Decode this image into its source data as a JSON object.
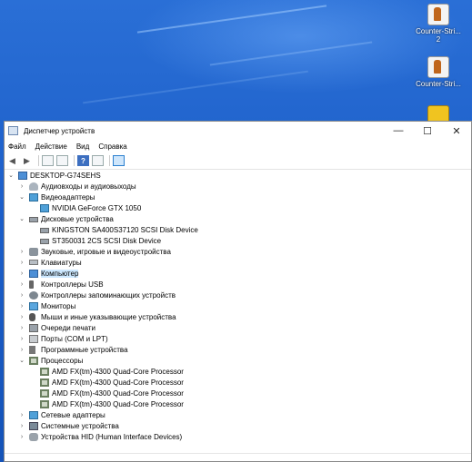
{
  "desktop": {
    "icons": [
      {
        "label": "Counter-Strike 2",
        "line1": "Counter-Stri...",
        "line2": "2"
      },
      {
        "label": "Counter-Strike",
        "line1": "Counter-Stri...",
        "line2": ""
      }
    ]
  },
  "window": {
    "title": "Диспетчер устройств",
    "controls": {
      "minimize": "—",
      "maximize": "☐",
      "close": "✕"
    }
  },
  "menu": [
    "Файл",
    "Действие",
    "Вид",
    "Справка"
  ],
  "toolbar": {
    "back": "◀",
    "forward": "▶",
    "help": "?"
  },
  "tree": {
    "root": "DESKTOP-G74SEHS",
    "expanded_arrow": "⌄",
    "collapsed_arrow": "›",
    "items": [
      {
        "label": "Аудиовходы и аудиовыходы",
        "icon": "audio-icon",
        "expanded": false,
        "children": []
      },
      {
        "label": "Видеоадаптеры",
        "icon": "display-adapter-icon",
        "expanded": true,
        "children": [
          "NVIDIA GeForce GTX 1050"
        ]
      },
      {
        "label": "Дисковые устройства",
        "icon": "disk-icon",
        "expanded": true,
        "children": [
          "KINGSTON  SA400S37120 SCSI Disk Device",
          "ST350031 2CS SCSI Disk Device"
        ]
      },
      {
        "label": "Звуковые, игровые и видеоустройства",
        "icon": "sound-icon",
        "expanded": false,
        "children": []
      },
      {
        "label": "Клавиатуры",
        "icon": "keyboard-icon",
        "expanded": false,
        "children": []
      },
      {
        "label": "Компьютер",
        "icon": "computer-icon",
        "expanded": false,
        "selected": true,
        "children": []
      },
      {
        "label": "Контроллеры USB",
        "icon": "usb-icon",
        "expanded": false,
        "children": []
      },
      {
        "label": "Контроллеры запоминающих устройств",
        "icon": "storage-controller-icon",
        "expanded": false,
        "children": []
      },
      {
        "label": "Мониторы",
        "icon": "monitor-icon",
        "expanded": false,
        "children": []
      },
      {
        "label": "Мыши и иные указывающие устройства",
        "icon": "mouse-icon",
        "expanded": false,
        "children": []
      },
      {
        "label": "Очереди печати",
        "icon": "print-queue-icon",
        "expanded": false,
        "children": []
      },
      {
        "label": "Порты (COM и LPT)",
        "icon": "port-icon",
        "expanded": false,
        "children": []
      },
      {
        "label": "Программные устройства",
        "icon": "software-device-icon",
        "expanded": false,
        "children": []
      },
      {
        "label": "Процессоры",
        "icon": "processor-icon",
        "expanded": true,
        "children": [
          "AMD FX(tm)-4300 Quad-Core Processor",
          "AMD FX(tm)-4300 Quad-Core Processor",
          "AMD FX(tm)-4300 Quad-Core Processor",
          "AMD FX(tm)-4300 Quad-Core Processor"
        ]
      },
      {
        "label": "Сетевые адаптеры",
        "icon": "network-adapter-icon",
        "expanded": false,
        "children": []
      },
      {
        "label": "Системные устройства",
        "icon": "system-device-icon",
        "expanded": false,
        "children": []
      },
      {
        "label": "Устройства HID (Human Interface Devices)",
        "icon": "hid-icon",
        "expanded": false,
        "children": []
      }
    ]
  }
}
